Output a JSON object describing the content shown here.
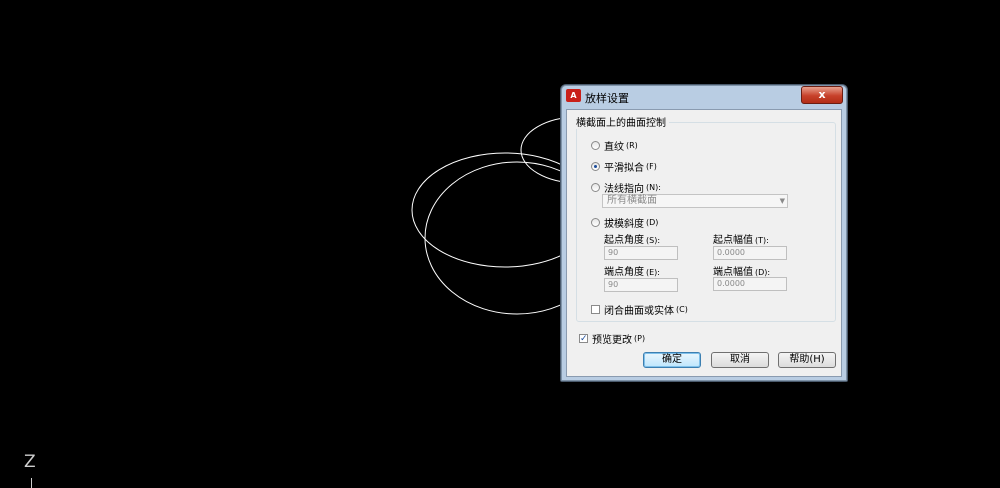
{
  "canvas": {
    "ucs_label": "Z"
  },
  "dialog": {
    "title": "放样设置",
    "close_label": "x",
    "app_icon_text": "A",
    "group_title": "横截面上的曲面控制",
    "options": {
      "ruled": {
        "label": "直纹",
        "accel": "(R)"
      },
      "smooth_fit": {
        "label": "平滑拟合",
        "accel": "(F)"
      },
      "normal_to": {
        "label": "法线指向",
        "accel": "(N):"
      },
      "draft_angles": {
        "label": "拔模斜度",
        "accel": "(D)"
      }
    },
    "normal_to_select": "所有横截面",
    "draft": {
      "start_angle_label": "起点角度",
      "start_angle_accel": "(S):",
      "start_angle_value": "90",
      "start_magnitude_label": "起点幅值",
      "start_magnitude_accel": "(T):",
      "start_magnitude_value": "0.0000",
      "end_angle_label": "端点角度",
      "end_angle_accel": "(E):",
      "end_angle_value": "90",
      "end_magnitude_label": "端点幅值",
      "end_magnitude_accel": "(D):",
      "end_magnitude_value": "0.0000"
    },
    "close_surface": {
      "label": "闭合曲面或实体",
      "accel": "(C)"
    },
    "preview": {
      "label": "预览更改",
      "accel": "(P)"
    },
    "buttons": {
      "ok": "确定",
      "cancel": "取消",
      "help": "帮助(H)"
    },
    "state": {
      "selected_option": "smooth_fit",
      "close_surface_checked": false,
      "preview_checked": true
    }
  },
  "colors": {
    "canvas_bg": "#000000",
    "curve": "#ffffff",
    "dialog_frame": "#b9cde3",
    "close_button": "#c7412a"
  }
}
